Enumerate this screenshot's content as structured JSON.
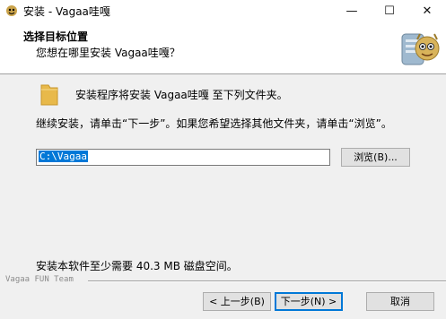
{
  "window": {
    "title": "安装 - Vagaa哇嘎",
    "minimize_glyph": "—",
    "maximize_glyph": "☐",
    "close_glyph": "✕"
  },
  "header": {
    "title": "选择目标位置",
    "subtitle": "您想在哪里安装 Vagaa哇嘎？"
  },
  "body": {
    "install_to_text": "安装程序将安装 Vagaa哇嘎 至下列文件夹。",
    "continue_text": "继续安装，请单击“下一步”。如果您希望选择其他文件夹，请单击“浏览”。",
    "path_value": "C:\\Vagaa",
    "browse_label": "浏览(B)...",
    "space_text": "安装本软件至少需要 40.3 MB 磁盘空间。"
  },
  "footer": {
    "branding": "Vagaa FUN Team",
    "back_label": "< 上一步(B)",
    "next_label": "下一步(N) >",
    "cancel_label": "取消"
  },
  "icons": {
    "app": "vagaa-app-icon",
    "header": "vagaa-mascot-icon",
    "folder": "folder-icon"
  },
  "colors": {
    "selection": "#0078d7",
    "folder": "#e8b94a"
  }
}
